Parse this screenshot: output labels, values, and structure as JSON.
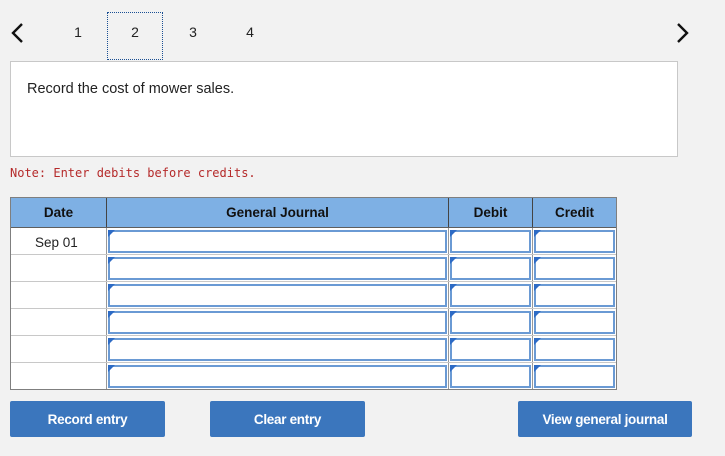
{
  "nav": {
    "steps": [
      "1",
      "2",
      "3",
      "4"
    ],
    "active_step": "2"
  },
  "instruction": "Record the cost of mower sales.",
  "note": "Note: Enter debits before credits.",
  "journal": {
    "headers": {
      "date": "Date",
      "account": "General Journal",
      "debit": "Debit",
      "credit": "Credit"
    },
    "rows": [
      {
        "date": "Sep 01",
        "account": "",
        "debit": "",
        "credit": ""
      },
      {
        "date": "",
        "account": "",
        "debit": "",
        "credit": ""
      },
      {
        "date": "",
        "account": "",
        "debit": "",
        "credit": ""
      },
      {
        "date": "",
        "account": "",
        "debit": "",
        "credit": ""
      },
      {
        "date": "",
        "account": "",
        "debit": "",
        "credit": ""
      },
      {
        "date": "",
        "account": "",
        "debit": "",
        "credit": ""
      }
    ]
  },
  "buttons": {
    "record": "Record entry",
    "clear": "Clear entry",
    "view": "View general journal"
  },
  "colors": {
    "header_bg": "#7eb0e4",
    "button_bg": "#3b76bd",
    "note_text": "#b52a2a"
  }
}
